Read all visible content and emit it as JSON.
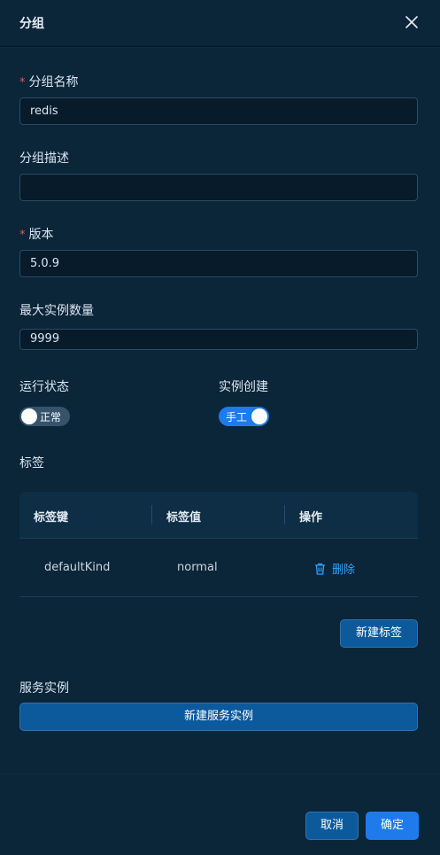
{
  "drawer": {
    "title": "分组"
  },
  "form": {
    "group_name": {
      "label": "分组名称",
      "required_mark": "*",
      "value": "redis"
    },
    "group_desc": {
      "label": "分组描述",
      "value": ""
    },
    "version": {
      "label": "版本",
      "required_mark": "*",
      "value": "5.0.9"
    },
    "max_instances": {
      "label": "最大实例数量",
      "value": "9999"
    },
    "run_state": {
      "label": "运行状态",
      "toggle_text": "正常",
      "on": false
    },
    "instance_create": {
      "label": "实例创建",
      "toggle_text": "手工",
      "on": true
    },
    "tags": {
      "label": "标签",
      "columns": [
        "标签键",
        "标签值",
        "操作"
      ],
      "rows": [
        {
          "key": "defaultKind",
          "value": "normal",
          "action": "删除"
        }
      ],
      "new_button": "新建标签"
    },
    "service_instances": {
      "label": "服务实例",
      "new_button": "新建服务实例"
    }
  },
  "footer": {
    "cancel": "取消",
    "confirm": "确定"
  },
  "colors": {
    "primary": "#1f7aeb",
    "secondary_button": "#0c5a9c",
    "link": "#2fa3ff",
    "required": "#f0524f"
  }
}
